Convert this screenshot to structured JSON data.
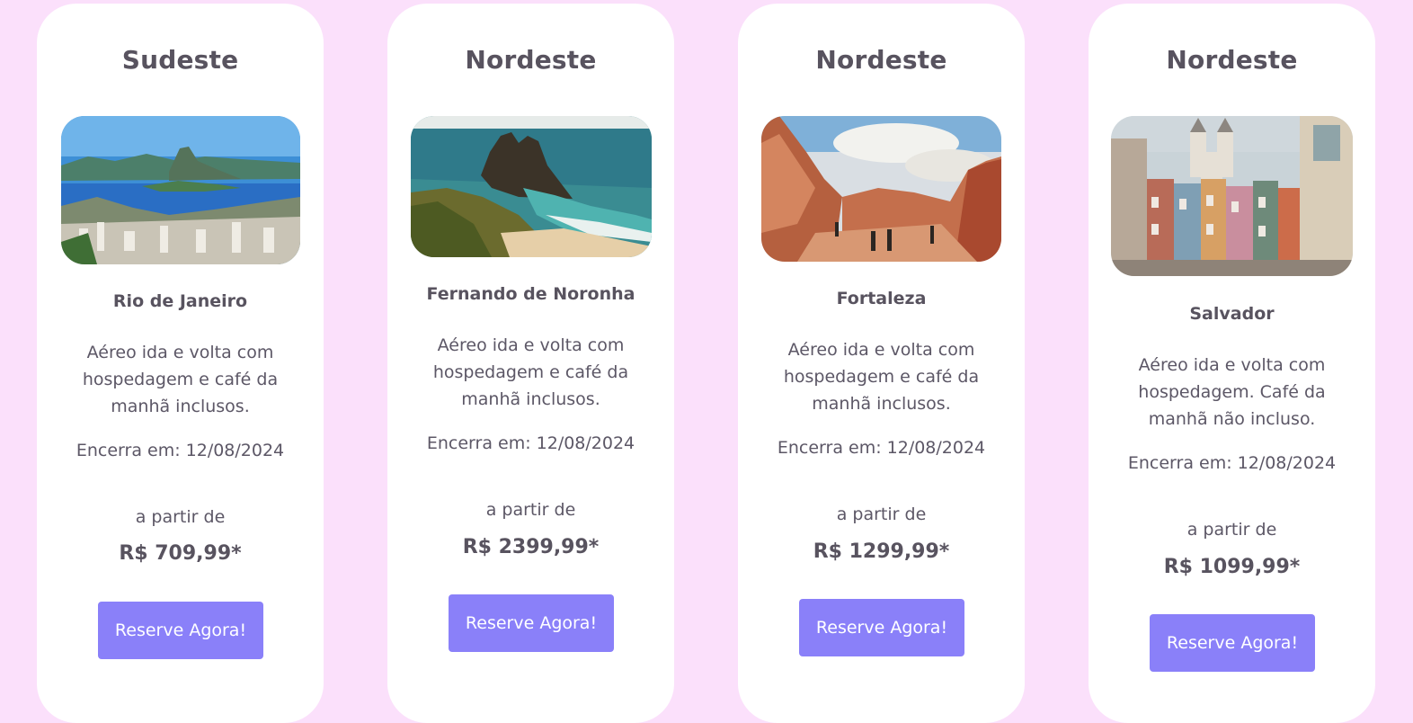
{
  "cards": [
    {
      "region": "Sudeste",
      "image_icon": "rio-de-janeiro-bay-photo",
      "city": "Rio de Janeiro",
      "description": "Aéreo ida e volta com hospedagem e café da manhã inclusos.",
      "deadline": "Encerra em: 12/08/2024",
      "from_label": "a partir de",
      "price": "R$ 709,99*",
      "button_label": "Reserve Agora!"
    },
    {
      "region": "Nordeste",
      "image_icon": "fernando-de-noronha-beach-photo",
      "city": "Fernando de Noronha",
      "description": "Aéreo ida e volta com hospedagem e café da manhã inclusos.",
      "deadline": "Encerra em: 12/08/2024",
      "from_label": "a partir de",
      "price": "R$ 2399,99*",
      "button_label": "Reserve Agora!"
    },
    {
      "region": "Nordeste",
      "image_icon": "fortaleza-canyon-photo",
      "city": "Fortaleza",
      "description": "Aéreo ida e volta com hospedagem e café da manhã inclusos.",
      "deadline": "Encerra em: 12/08/2024",
      "from_label": "a partir de",
      "price": "R$ 1299,99*",
      "button_label": "Reserve Agora!"
    },
    {
      "region": "Nordeste",
      "image_icon": "salvador-pelourinho-photo",
      "city": "Salvador",
      "description": "Aéreo ida e volta com hospedagem. Café da manhã não incluso.",
      "deadline": "Encerra em: 12/08/2024",
      "from_label": "a partir de",
      "price": "R$ 1099,99*",
      "button_label": "Reserve Agora!"
    }
  ],
  "colors": {
    "page_background": "#fbe0fb",
    "card_background": "#ffffff",
    "button": "#8a80f9",
    "text": "#58535f"
  }
}
